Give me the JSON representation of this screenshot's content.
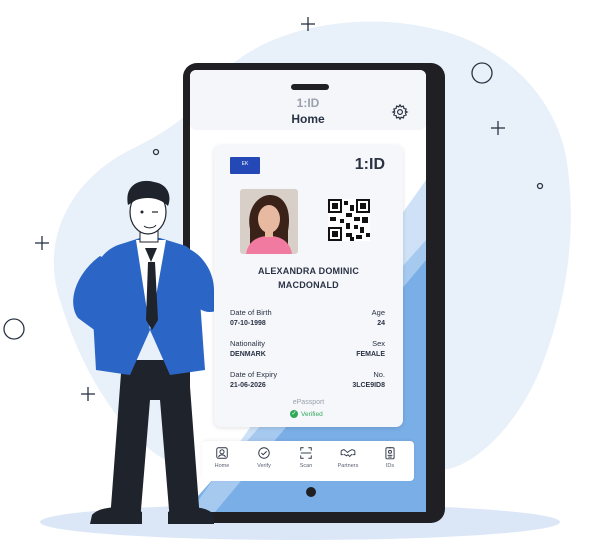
{
  "app": {
    "logo": "1:ID",
    "title": "Home",
    "settings_icon": "gear-icon"
  },
  "card": {
    "flag_text": "EK",
    "logo": "1:ID",
    "name_line1": "ALEXANDRA DOMINIC",
    "name_line2": "MACDONALD",
    "fields": {
      "dob_label": "Date of Birth",
      "dob": "07-10-1998",
      "age_label": "Age",
      "age": "24",
      "nationality_label": "Nationality",
      "nationality": "DENMARK",
      "sex_label": "Sex",
      "sex": "FEMALE",
      "expiry_label": "Date of Expiry",
      "expiry": "21-06-2026",
      "no_label": "No.",
      "no": "3LCE9ID8"
    },
    "doc_type": "ePassport",
    "status": "Verified"
  },
  "nav": [
    {
      "label": "Home",
      "icon": "home-icon"
    },
    {
      "label": "Verify",
      "icon": "verify-icon"
    },
    {
      "label": "Scan",
      "icon": "scan-icon"
    },
    {
      "label": "Partners",
      "icon": "handshake-icon"
    },
    {
      "label": "IDs",
      "icon": "id-badge-icon"
    }
  ],
  "colors": {
    "accent": "#2a6fd6",
    "blob": "#e8f0fa",
    "verified": "#2fa85a",
    "phone": "#1f1f24"
  }
}
